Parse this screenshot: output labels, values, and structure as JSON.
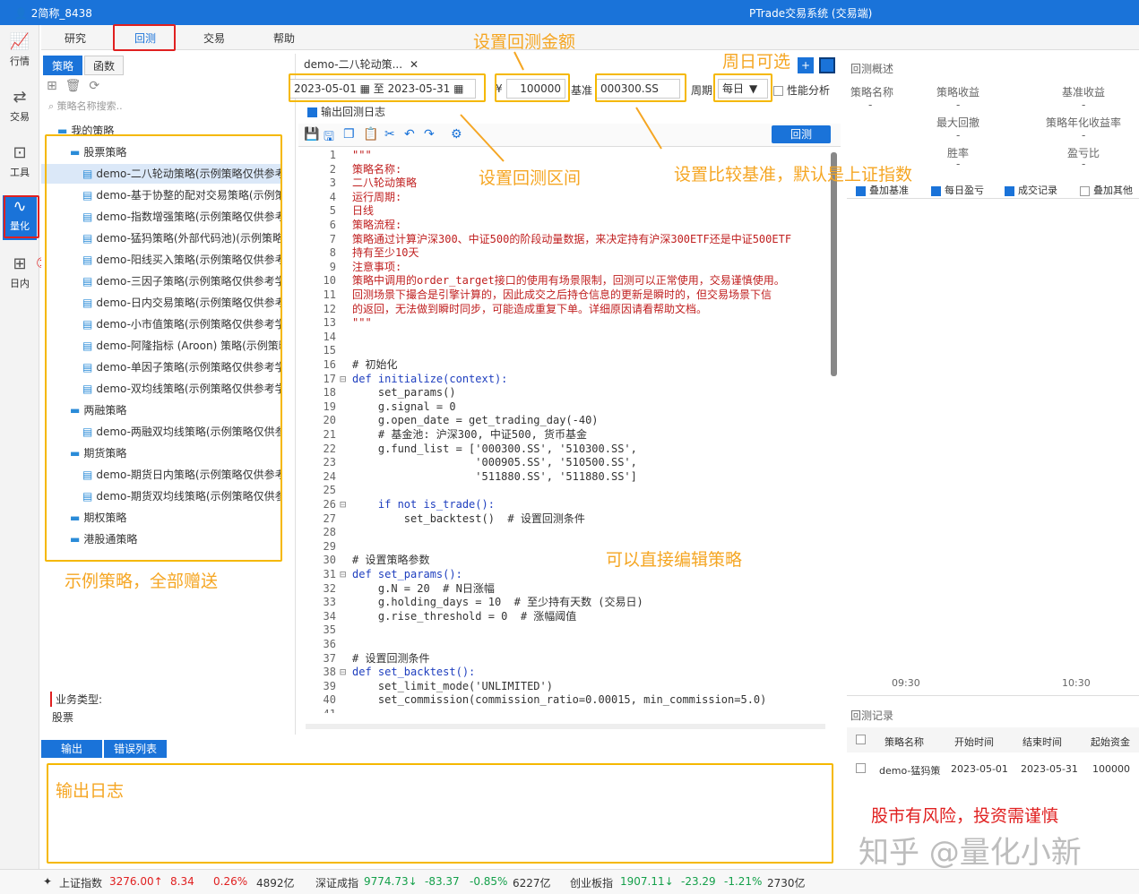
{
  "titlebar": {
    "user": "2简称_8438",
    "title": "PTrade交易系统 (交易端)"
  },
  "nav": [
    {
      "icon": "chart-icon",
      "label": "行情"
    },
    {
      "icon": "trade-icon",
      "label": "交易"
    },
    {
      "icon": "toolbox-icon",
      "label": "工具"
    },
    {
      "icon": "quant-icon",
      "label": "量化"
    },
    {
      "icon": "intraday-icon",
      "label": "日内"
    }
  ],
  "menu": [
    "研究",
    "回测",
    "交易",
    "帮助"
  ],
  "left": {
    "tabs": [
      "策略",
      "函数"
    ],
    "search_placeholder": "策略名称搜索..",
    "tree": [
      {
        "label": "我的策略",
        "type": "folder",
        "level": 0
      },
      {
        "label": "股票策略",
        "type": "folder",
        "level": 1
      },
      {
        "label": "demo-二八轮动策略(示例策略仅供参考学",
        "type": "file",
        "level": 2,
        "selected": true
      },
      {
        "label": "demo-基于协整的配对交易策略(示例策略",
        "type": "file",
        "level": 2
      },
      {
        "label": "demo-指数增强策略(示例策略仅供参考学",
        "type": "file",
        "level": 2
      },
      {
        "label": "demo-猛犸策略(外部代码池)(示例策略仅",
        "type": "file",
        "level": 2
      },
      {
        "label": "demo-阳线买入策略(示例策略仅供参考学",
        "type": "file",
        "level": 2
      },
      {
        "label": "demo-三因子策略(示例策略仅供参考学习",
        "type": "file",
        "level": 2
      },
      {
        "label": "demo-日内交易策略(示例策略仅供参考学",
        "type": "file",
        "level": 2
      },
      {
        "label": "demo-小市值策略(示例策略仅供参考学习",
        "type": "file",
        "level": 2
      },
      {
        "label": "demo-阿隆指标 (Aroon) 策略(示例策略",
        "type": "file",
        "level": 2
      },
      {
        "label": "demo-单因子策略(示例策略仅供参考学习",
        "type": "file",
        "level": 2
      },
      {
        "label": "demo-双均线策略(示例策略仅供参考学习",
        "type": "file",
        "level": 2
      },
      {
        "label": "两融策略",
        "type": "folder",
        "level": 1
      },
      {
        "label": "demo-两融双均线策略(示例策略仅供参考",
        "type": "file",
        "level": 2
      },
      {
        "label": "期货策略",
        "type": "folder",
        "level": 1
      },
      {
        "label": "demo-期货日内策略(示例策略仅供参考学",
        "type": "file",
        "level": 2
      },
      {
        "label": "demo-期货双均线策略(示例策略仅供参考",
        "type": "file",
        "level": 2
      },
      {
        "label": "期权策略",
        "type": "folder",
        "level": 1
      },
      {
        "label": "港股通策略",
        "type": "folder",
        "level": 1
      }
    ],
    "biz_label": "业务类型:",
    "biz_value": "股票"
  },
  "editor": {
    "file_tab": "demo-二八轮动策...",
    "start_date": "2023-05-01",
    "to": "至",
    "end_date": "2023-05-31",
    "currency": "¥",
    "amount": "100000",
    "benchmark_label": "基准",
    "benchmark": "000300.SS",
    "period_label": "周期",
    "period": "每日",
    "perf_label": "性能分析",
    "log_label": "输出回测日志",
    "backtest_btn": "回测",
    "code": [
      {
        "n": "1",
        "t": "\"\"\"",
        "c": "red"
      },
      {
        "n": "2",
        "t": "策略名称:",
        "c": "red"
      },
      {
        "n": "3",
        "t": "二八轮动策略",
        "c": "red"
      },
      {
        "n": "4",
        "t": "运行周期:",
        "c": "red"
      },
      {
        "n": "5",
        "t": "日线",
        "c": "red"
      },
      {
        "n": "6",
        "t": "策略流程:",
        "c": "red"
      },
      {
        "n": "7",
        "t": "策略通过计算沪深300、中证500的阶段动量数据，来决定持有沪深300ETF还是中证500ETF",
        "c": "red"
      },
      {
        "n": "8",
        "t": "持有至少10天",
        "c": "red"
      },
      {
        "n": "9",
        "t": "注意事项:",
        "c": "red"
      },
      {
        "n": "10",
        "t": "策略中调用的order_target接口的使用有场景限制，回测可以正常使用，交易谨慎使用。",
        "c": "red"
      },
      {
        "n": "11",
        "t": "回测场景下撮合是引擎计算的，因此成交之后持仓信息的更新是瞬时的，但交易场景下信",
        "c": "red"
      },
      {
        "n": "12",
        "t": "的返回，无法做到瞬时同步，可能造成重复下单。详细原因请看帮助文档。",
        "c": "red"
      },
      {
        "n": "13",
        "t": "\"\"\"",
        "c": "red"
      },
      {
        "n": "14",
        "t": "",
        "c": ""
      },
      {
        "n": "15",
        "t": "",
        "c": ""
      },
      {
        "n": "16",
        "t": "# 初始化",
        "c": ""
      },
      {
        "n": "17",
        "t": "def initialize(context):",
        "c": "def",
        "fold": "⊟"
      },
      {
        "n": "18",
        "t": "    set_params()",
        "c": ""
      },
      {
        "n": "19",
        "t": "    g.signal = 0",
        "c": ""
      },
      {
        "n": "20",
        "t": "    g.open_date = get_trading_day(-40)",
        "c": ""
      },
      {
        "n": "21",
        "t": "    # 基金池: 沪深300, 中证500, 货币基金",
        "c": ""
      },
      {
        "n": "22",
        "t": "    g.fund_list = ['000300.SS', '510300.SS',",
        "c": "str"
      },
      {
        "n": "23",
        "t": "                   '000905.SS', '510500.SS',",
        "c": "str"
      },
      {
        "n": "24",
        "t": "                   '511880.SS', '511880.SS']",
        "c": "str"
      },
      {
        "n": "25",
        "t": "",
        "c": ""
      },
      {
        "n": "26",
        "t": "    if not is_trade():",
        "c": "kw",
        "fold": "⊟"
      },
      {
        "n": "27",
        "t": "        set_backtest()  # 设置回测条件",
        "c": ""
      },
      {
        "n": "28",
        "t": "",
        "c": ""
      },
      {
        "n": "29",
        "t": "",
        "c": ""
      },
      {
        "n": "30",
        "t": "# 设置策略参数",
        "c": ""
      },
      {
        "n": "31",
        "t": "def set_params():",
        "c": "def",
        "fold": "⊟"
      },
      {
        "n": "32",
        "t": "    g.N = 20  # N日涨幅",
        "c": ""
      },
      {
        "n": "33",
        "t": "    g.holding_days = 10  # 至少持有天数 (交易日)",
        "c": ""
      },
      {
        "n": "34",
        "t": "    g.rise_threshold = 0  # 涨幅阈值",
        "c": ""
      },
      {
        "n": "35",
        "t": "",
        "c": ""
      },
      {
        "n": "36",
        "t": "",
        "c": ""
      },
      {
        "n": "37",
        "t": "# 设置回测条件",
        "c": ""
      },
      {
        "n": "38",
        "t": "def set_backtest():",
        "c": "def",
        "fold": "⊟"
      },
      {
        "n": "39",
        "t": "    set_limit_mode('UNLIMITED')",
        "c": "str"
      },
      {
        "n": "40",
        "t": "    set_commission(commission_ratio=0.00015, min_commission=5.0)",
        "c": "num"
      },
      {
        "n": "41",
        "t": "",
        "c": ""
      }
    ]
  },
  "right": {
    "overview_title": "回测概述",
    "metrics": [
      {
        "label": "策略名称",
        "value": "-"
      },
      {
        "label": "策略收益",
        "value": "-"
      },
      {
        "label": "基准收益",
        "value": "-"
      },
      {
        "label": "最大回撤",
        "value": "-"
      },
      {
        "label": "策略年化收益率",
        "value": "-"
      },
      {
        "label": "胜率",
        "value": "-"
      },
      {
        "label": "盈亏比",
        "value": "-"
      }
    ],
    "checks": [
      "叠加基准",
      "每日盈亏",
      "成交记录",
      "叠加其他"
    ],
    "times": [
      "09:30",
      "10:30"
    ],
    "records_title": "回测记录",
    "records_headers": [
      "策略名称",
      "开始时间",
      "结束时间",
      "起始资金"
    ],
    "records_rows": [
      [
        "demo-猛犸策",
        "2023-05-01",
        "2023-05-31",
        "100000"
      ]
    ]
  },
  "bottom": {
    "tabs": [
      "输出",
      "错误列表"
    ]
  },
  "status": [
    {
      "name": "上证指数",
      "price": "3276.00",
      "dir": "up",
      "chg": "8.34",
      "pct": "0.26%",
      "vol": "4892亿"
    },
    {
      "name": "深证成指",
      "price": "9774.73",
      "dir": "down",
      "chg": "-83.37",
      "pct": "-0.85%",
      "vol": "6227亿"
    },
    {
      "name": "创业板指",
      "price": "1907.11",
      "dir": "down",
      "chg": "-23.29",
      "pct": "-1.21%",
      "vol": "2730亿"
    }
  ],
  "annotations": {
    "amount": "设置回测金额",
    "weekday": "周日可选",
    "interval": "设置回测区间",
    "benchmark": "设置比较基准，默认是上证指数",
    "edit": "可以直接编辑策略",
    "examples": "示例策略，全部赠送",
    "log": "输出日志",
    "risk": "股市有风险，投资需谨慎",
    "c1": "①",
    "c2": "②",
    "watermark": "知乎 @量化小新"
  },
  "colors": {
    "accent": "#1a73d9",
    "annotation": "#f5a623",
    "up": "#e02020",
    "down": "#14a04a"
  }
}
